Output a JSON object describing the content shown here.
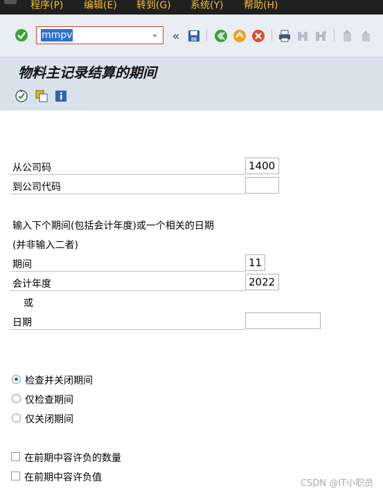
{
  "menubar": {
    "items": [
      "程序(P)",
      "编辑(E)",
      "转到(G)",
      "系统(Y)",
      "帮助(H)"
    ]
  },
  "toolbar": {
    "command_value": "mmpv",
    "icons": [
      "check-icon",
      "save-icon",
      "back-icon",
      "exit-icon",
      "cancel-icon",
      "print-icon",
      "find-icon",
      "find-next-icon",
      "first-page-icon",
      "previous-page-icon"
    ]
  },
  "screen": {
    "title": "物料主记录结算的期间"
  },
  "form": {
    "from_company_label": "从公司码",
    "from_company_value": "1400",
    "to_company_label": "到公司代码",
    "to_company_value": "",
    "instruction_line1": "输入下个期间(包括会计年度)或一个相关的日期",
    "instruction_line2": "(并非输入二者)",
    "period_label": "期间",
    "period_value": "11",
    "fiscal_year_label": "会计年度",
    "fiscal_year_value": "2022",
    "or_label": "或",
    "date_label": "日期",
    "date_value": "",
    "radio_options": [
      {
        "label": "检查并关闭期间",
        "selected": true
      },
      {
        "label": "仅检查期间",
        "selected": false
      },
      {
        "label": "仅关闭期间",
        "selected": false
      }
    ],
    "checkbox_options": [
      {
        "label": "在前期中容许负的数量",
        "checked": false
      },
      {
        "label": "在前期中容许负值",
        "checked": false
      }
    ]
  },
  "watermark": "CSDN @IT小职员"
}
